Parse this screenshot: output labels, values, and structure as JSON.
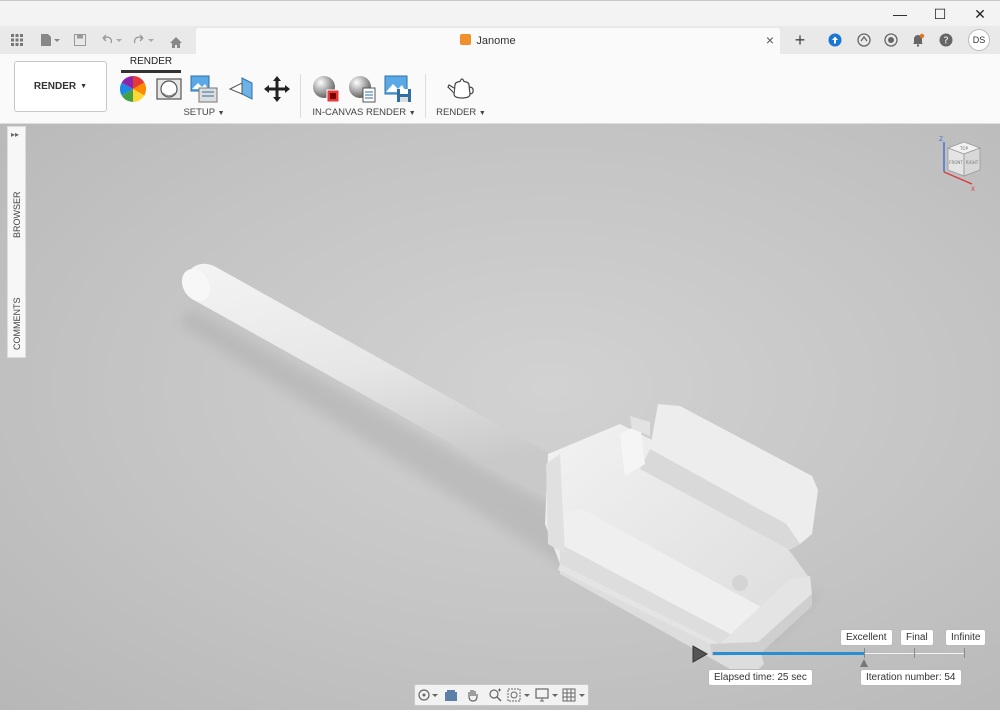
{
  "window": {
    "minimize_glyph": "—",
    "maximize_glyph": "☐",
    "close_glyph": "✕"
  },
  "document_tab": {
    "title": "Janome",
    "close_glyph": "×",
    "new_tab_glyph": "+"
  },
  "user": {
    "initials": "DS"
  },
  "toolbar": {
    "workspace_label": "RENDER",
    "active_tab": "RENDER",
    "groups": {
      "setup": "SETUP",
      "in_canvas_render": "IN-CANVAS RENDER",
      "render": "RENDER"
    }
  },
  "side_panel": {
    "browser": "BROWSER",
    "comments": "COMMENTS"
  },
  "render_progress": {
    "quality_levels": [
      "Excellent",
      "Final",
      "Infinite"
    ],
    "progress_fraction": 0.6,
    "elapsed_label": "Elapsed time: 25 sec",
    "iteration_label": "Iteration number: 54",
    "accent_color": "#2a8fd1"
  },
  "viewcube": {
    "faces": [
      "TOP",
      "FRONT",
      "RIGHT"
    ],
    "axes": [
      "Z",
      "X"
    ]
  },
  "nav_icons": [
    "orbit-icon",
    "look-at-icon",
    "pan-icon",
    "zoom-icon",
    "fit-icon",
    "display-settings-icon",
    "grid-settings-icon"
  ]
}
